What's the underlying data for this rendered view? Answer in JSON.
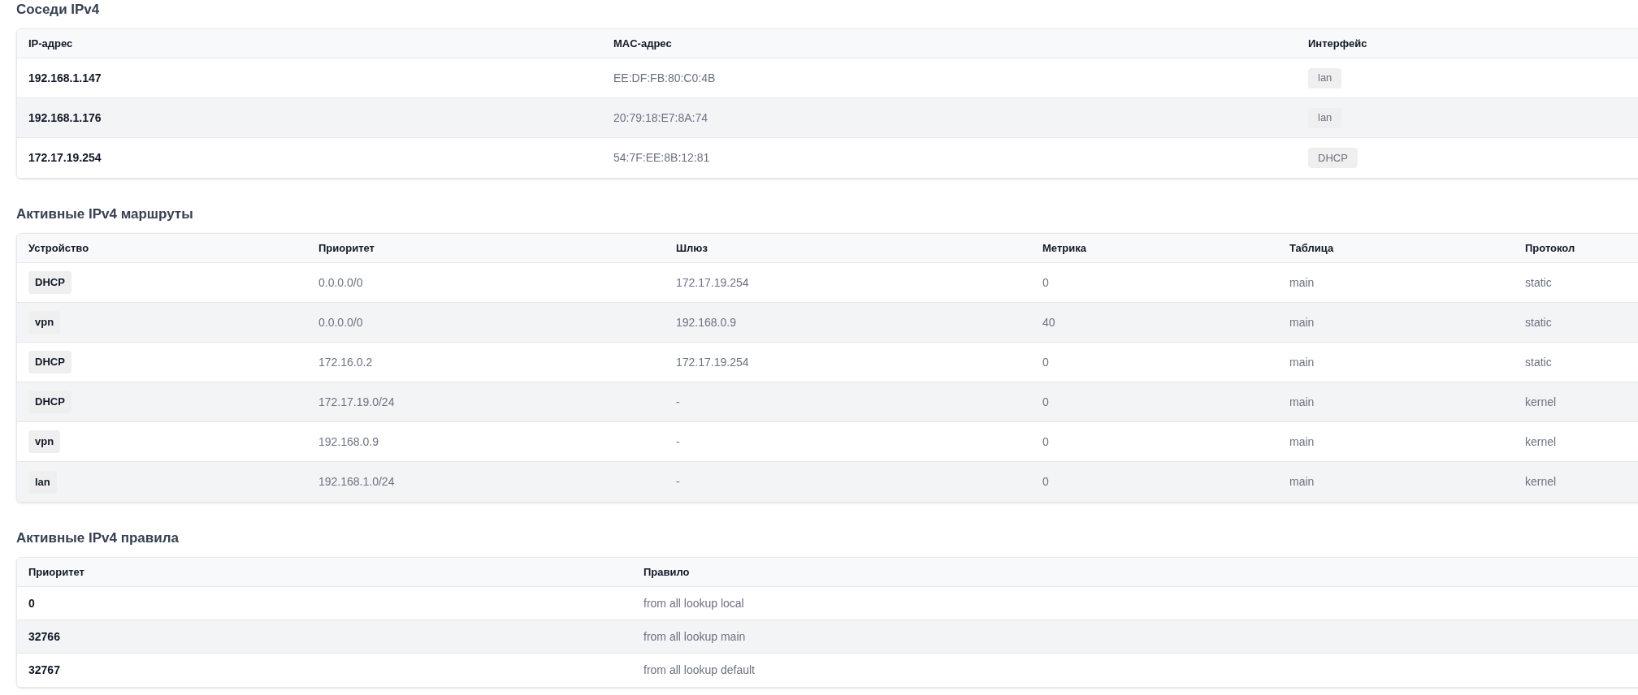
{
  "sections": [
    {
      "title": "Соседи IPv4",
      "columns": [
        "IP-адрес",
        "MAC-адрес",
        "Интерфейс"
      ],
      "rows": [
        [
          {
            "kind": "strong",
            "text": "192.168.1.147"
          },
          {
            "kind": "plain",
            "text": "EE:DF:FB:80:C0:4B"
          },
          {
            "kind": "tag",
            "text": "lan"
          }
        ],
        [
          {
            "kind": "strong",
            "text": "192.168.1.176"
          },
          {
            "kind": "plain",
            "text": "20:79:18:E7:8A:74"
          },
          {
            "kind": "tag",
            "text": "lan"
          }
        ],
        [
          {
            "kind": "strong",
            "text": "172.17.19.254"
          },
          {
            "kind": "plain",
            "text": "54:7F:EE:8B:12:81"
          },
          {
            "kind": "tag",
            "text": "DHCP"
          }
        ]
      ]
    },
    {
      "title": "Активные IPv4 маршруты",
      "columns": [
        "Устройство",
        "Приоритет",
        "Шлюз",
        "Метрика",
        "Таблица",
        "Протокол"
      ],
      "rows": [
        [
          {
            "kind": "device",
            "text": "DHCP"
          },
          {
            "kind": "plain",
            "text": "0.0.0.0/0"
          },
          {
            "kind": "plain",
            "text": "172.17.19.254"
          },
          {
            "kind": "plain",
            "text": "0"
          },
          {
            "kind": "plain",
            "text": "main"
          },
          {
            "kind": "plain",
            "text": "static"
          }
        ],
        [
          {
            "kind": "device",
            "text": "vpn"
          },
          {
            "kind": "plain",
            "text": "0.0.0.0/0"
          },
          {
            "kind": "plain",
            "text": "192.168.0.9"
          },
          {
            "kind": "plain",
            "text": "40"
          },
          {
            "kind": "plain",
            "text": "main"
          },
          {
            "kind": "plain",
            "text": "static"
          }
        ],
        [
          {
            "kind": "device",
            "text": "DHCP"
          },
          {
            "kind": "plain",
            "text": "172.16.0.2"
          },
          {
            "kind": "plain",
            "text": "172.17.19.254"
          },
          {
            "kind": "plain",
            "text": "0"
          },
          {
            "kind": "plain",
            "text": "main"
          },
          {
            "kind": "plain",
            "text": "static"
          }
        ],
        [
          {
            "kind": "device",
            "text": "DHCP"
          },
          {
            "kind": "plain",
            "text": "172.17.19.0/24"
          },
          {
            "kind": "plain",
            "text": "-"
          },
          {
            "kind": "plain",
            "text": "0"
          },
          {
            "kind": "plain",
            "text": "main"
          },
          {
            "kind": "plain",
            "text": "kernel"
          }
        ],
        [
          {
            "kind": "device",
            "text": "vpn"
          },
          {
            "kind": "plain",
            "text": "192.168.0.9"
          },
          {
            "kind": "plain",
            "text": "-"
          },
          {
            "kind": "plain",
            "text": "0"
          },
          {
            "kind": "plain",
            "text": "main"
          },
          {
            "kind": "plain",
            "text": "kernel"
          }
        ],
        [
          {
            "kind": "device",
            "text": "lan"
          },
          {
            "kind": "plain",
            "text": "192.168.1.0/24"
          },
          {
            "kind": "plain",
            "text": "-"
          },
          {
            "kind": "plain",
            "text": "0"
          },
          {
            "kind": "plain",
            "text": "main"
          },
          {
            "kind": "plain",
            "text": "kernel"
          }
        ]
      ]
    },
    {
      "title": "Активные IPv4 правила",
      "columns": [
        "Приоритет",
        "Правило"
      ],
      "rows": [
        [
          {
            "kind": "strong",
            "text": "0"
          },
          {
            "kind": "plain",
            "text": "from all lookup local"
          }
        ],
        [
          {
            "kind": "strong",
            "text": "32766"
          },
          {
            "kind": "plain",
            "text": "from all lookup main"
          }
        ],
        [
          {
            "kind": "strong",
            "text": "32767"
          },
          {
            "kind": "plain",
            "text": "from all lookup default"
          }
        ]
      ]
    }
  ]
}
